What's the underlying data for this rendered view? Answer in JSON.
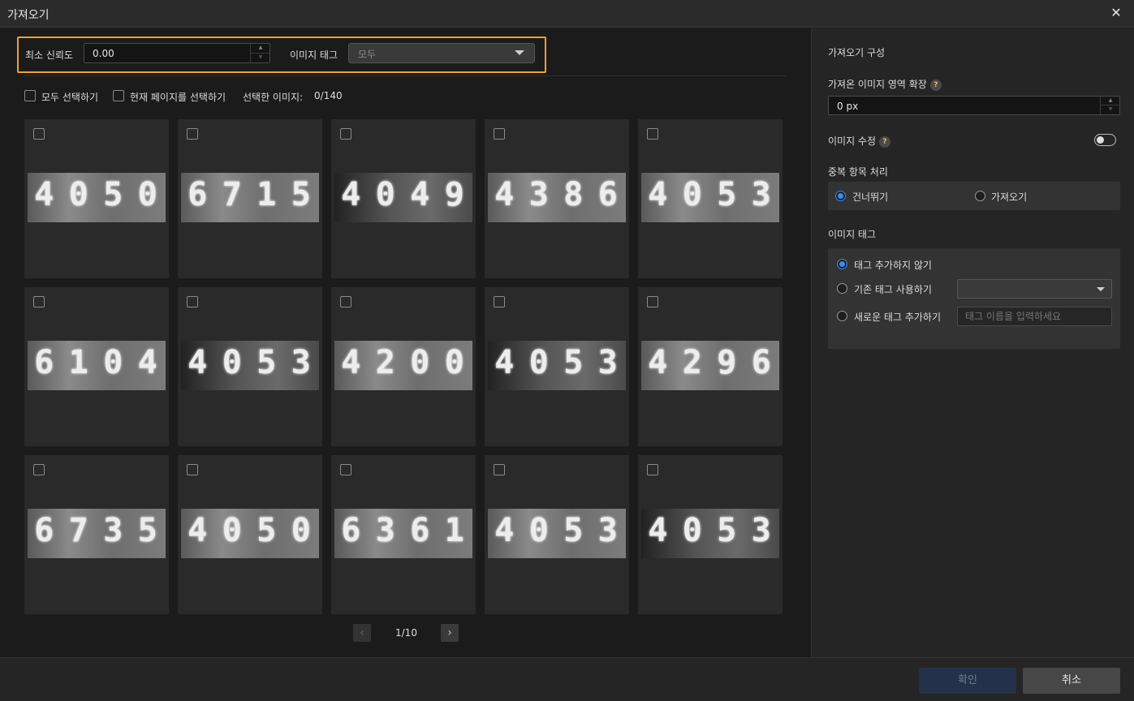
{
  "window": {
    "title": "가져오기",
    "close_icon": "close-icon"
  },
  "filter": {
    "min_confidence_label": "최소 신뢰도",
    "min_confidence_value": "0.00",
    "image_tag_label": "이미지 태그",
    "image_tag_value": "모두",
    "highlight_color": "#f0a030"
  },
  "selection": {
    "select_all_label": "모두 선택하기",
    "select_page_label": "현재 페이지를 선택하기",
    "selected_count_label": "선택한 이미지:",
    "selected_count_value": "0/140"
  },
  "images": [
    {
      "digits": "4050"
    },
    {
      "digits": "6715"
    },
    {
      "digits": "4049"
    },
    {
      "digits": "4386"
    },
    {
      "digits": "4053"
    },
    {
      "digits": "6104"
    },
    {
      "digits": "4053"
    },
    {
      "digits": "4200"
    },
    {
      "digits": "4053"
    },
    {
      "digits": "4296"
    },
    {
      "digits": "6735"
    },
    {
      "digits": "4050"
    },
    {
      "digits": "6361"
    },
    {
      "digits": "4053"
    },
    {
      "digits": "4053"
    }
  ],
  "pager": {
    "text": "1/10"
  },
  "config": {
    "title": "가져오기 구성",
    "expand_label": "가져온 이미지 영역 확장",
    "expand_value": "0 px",
    "edit_label": "이미지 수정",
    "duplicate_label": "중복 항목 처리",
    "skip_label": "건너뛰기",
    "import_label": "가져오기",
    "image_tag_title": "이미지 태그",
    "no_tag_label": "태그 추가하지 않기",
    "existing_tag_label": "기존 태그 사용하기",
    "new_tag_label": "새로운 태그 추가하기",
    "new_tag_placeholder": "태그 이름을 입력하세요",
    "accent_color": "#3b8cf0"
  },
  "footer": {
    "ok_label": "확인",
    "cancel_label": "취소"
  }
}
